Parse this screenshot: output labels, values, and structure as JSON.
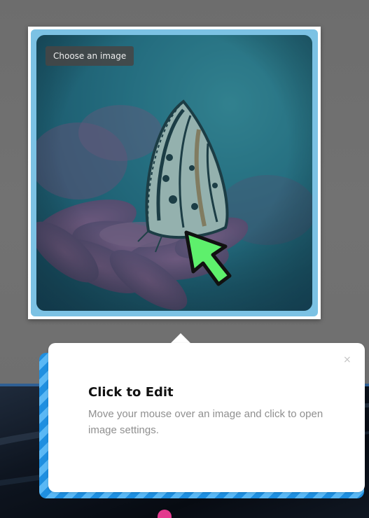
{
  "image_editor": {
    "choose_image_label": "Choose an image",
    "image_subject": "butterfly-on-pink-flower",
    "frame_color": "#7cc2e4",
    "overlay_tint": "#1f6d80"
  },
  "cursor": {
    "icon": "arrow-cursor-icon",
    "fill_color": "#5ef06c",
    "outline_color": "#111111"
  },
  "tooltip": {
    "title": "Click to Edit",
    "body": "Move your mouse over an image and click to open image settings.",
    "close_icon": "×",
    "stripe_colors": [
      "#1f8fe0",
      "#5ab8f5"
    ]
  },
  "background": {
    "top_color": "#6f6f6f",
    "bottom_color": "#0b111a",
    "accent_line_color": "#2f5f93"
  }
}
